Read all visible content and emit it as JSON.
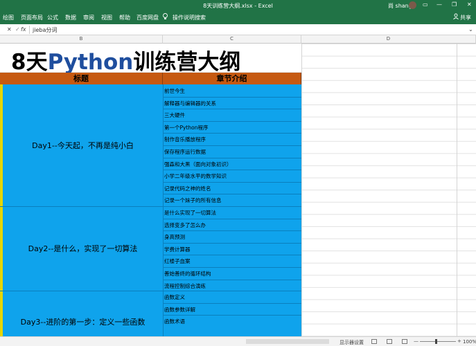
{
  "window": {
    "title": "8天训练营大纲.xlsx  -  Excel",
    "user": "尚 shang",
    "minimize": "—",
    "restore": "❐",
    "close": "✕",
    "ribbon_display": "▭"
  },
  "ribbon": {
    "tabs": [
      "绘图",
      "页面布局",
      "公式",
      "数据",
      "审阅",
      "视图",
      "帮助",
      "百度网盘"
    ],
    "tell_me": "操作说明搜索",
    "share": "共享"
  },
  "formula_bar": {
    "cancel": "✕",
    "enter": "✓",
    "fx": "fx",
    "content": "jieba分词",
    "expand": "⌄"
  },
  "columns": [
    "B",
    "C",
    "D"
  ],
  "sheet": {
    "title_part1": "8天",
    "title_part2": "Python",
    "title_part3": "训练营大纲",
    "header_title": "标题",
    "header_chapters": "章节介绍",
    "accent_colors": {
      "header": "#c65911",
      "block": "#0fa3ec",
      "python": "#1f4e9e"
    },
    "days": [
      {
        "label": "Day1--今天起，不再是纯小白",
        "topics": [
          "前世今生",
          "解释器与编辑器的关系",
          "三大硬件",
          "第一个Python程序",
          "制作音乐播放程序",
          "保存程序运行数据",
          "强森和大黑（面向对象初识）",
          "小学二年级水平的数学知识",
          "记录代码之神的姓名",
          "记录一个妹子的所有信息"
        ]
      },
      {
        "label": "Day2--是什么，实现了一切算法",
        "topics": [
          "是什么实现了一切算法",
          "选择变多了怎么办",
          "身高预测",
          "学费计算器",
          "红楼子血案",
          "善始善终的循环结构",
          "流程控制综合演练"
        ]
      },
      {
        "label": "Day3--进阶的第一步：定义一些函数",
        "topics": [
          "函数定义",
          "函数参数详解",
          "函数术语"
        ]
      }
    ]
  },
  "status_bar": {
    "display_settings": "显示器设置",
    "zoom": "100%",
    "zoom_out": "—",
    "zoom_in": "+"
  }
}
